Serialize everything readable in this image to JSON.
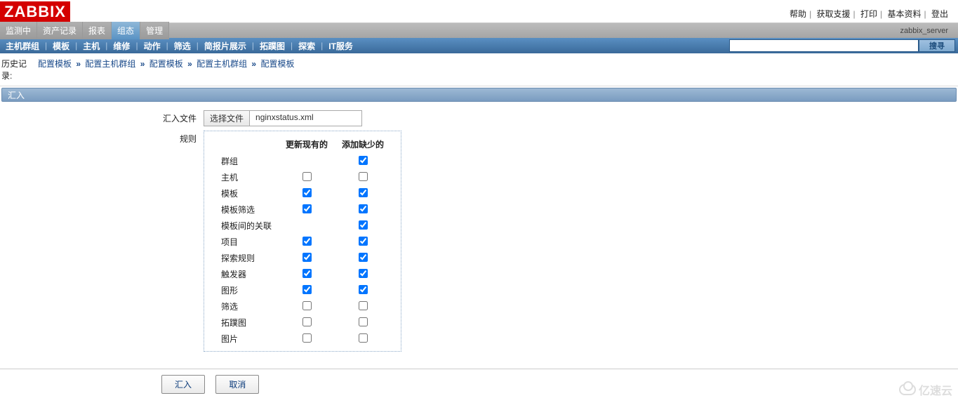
{
  "logo": "ZABBIX",
  "top_links": [
    "帮助",
    "获取支援",
    "打印",
    "基本资料",
    "登出"
  ],
  "server_name": "zabbix_server",
  "main_tabs": [
    {
      "label": "监测中",
      "active": false
    },
    {
      "label": "资产记录",
      "active": false
    },
    {
      "label": "报表",
      "active": false
    },
    {
      "label": "组态",
      "active": true
    },
    {
      "label": "管理",
      "active": false
    }
  ],
  "sub_tabs": [
    "主机群组",
    "模板",
    "主机",
    "维修",
    "动作",
    "筛选",
    "简报片展示",
    "拓蹼图",
    "探索",
    "IT服务"
  ],
  "search": {
    "button": "搜寻"
  },
  "history": {
    "label": "历史记录:",
    "items": [
      "配置模板",
      "配置主机群组",
      "配置模板",
      "配置主机群组",
      "配置模板"
    ]
  },
  "section_title": "汇入",
  "form": {
    "file_label": "汇入文件",
    "file_button": "选择文件",
    "file_name": "nginxstatus.xml",
    "rules_label": "规则",
    "col_update": "更新现有的",
    "col_add": "添加缺少的",
    "rows": [
      {
        "label": "群组",
        "update": null,
        "add": true
      },
      {
        "label": "主机",
        "update": false,
        "add": false
      },
      {
        "label": "模板",
        "update": true,
        "add": true
      },
      {
        "label": "模板筛选",
        "update": true,
        "add": true
      },
      {
        "label": "模板间的关联",
        "update": null,
        "add": true
      },
      {
        "label": "项目",
        "update": true,
        "add": true
      },
      {
        "label": "探索规则",
        "update": true,
        "add": true
      },
      {
        "label": "触发器",
        "update": true,
        "add": true
      },
      {
        "label": "图形",
        "update": true,
        "add": true
      },
      {
        "label": "筛选",
        "update": false,
        "add": false
      },
      {
        "label": "拓蹼图",
        "update": false,
        "add": false
      },
      {
        "label": "图片",
        "update": false,
        "add": false
      }
    ]
  },
  "buttons": {
    "import": "汇入",
    "cancel": "取消"
  },
  "watermark": "亿速云"
}
